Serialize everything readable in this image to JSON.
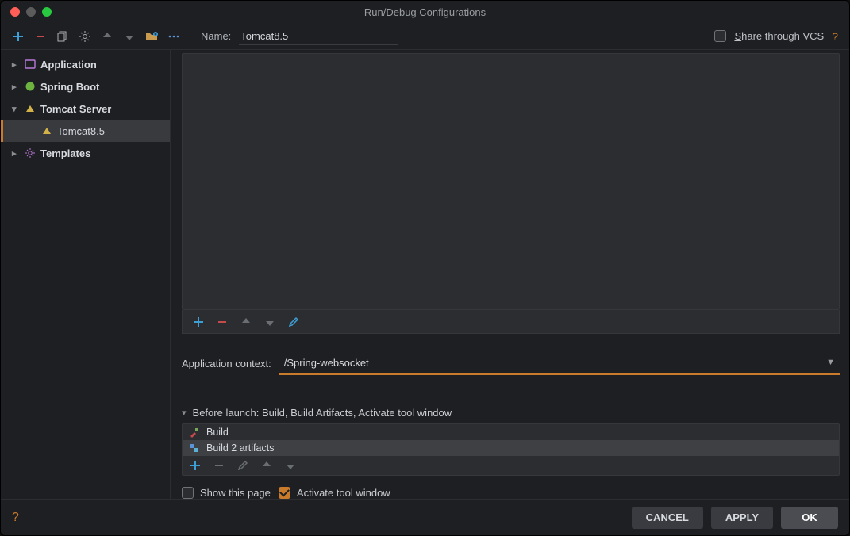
{
  "title": "Run/Debug Configurations",
  "toolbar": {
    "name_label": "Name:",
    "name_value": "Tomcat8.5",
    "share_label": "Share through VCS",
    "share_checked": false
  },
  "tree": {
    "application": "Application",
    "spring_boot": "Spring Boot",
    "tomcat_server": "Tomcat Server",
    "tomcat_child": "Tomcat8.5",
    "templates": "Templates"
  },
  "main": {
    "app_context_label": "Application context:",
    "app_context_value": "/Spring-websocket",
    "before_launch": "Before launch: Build, Build Artifacts, Activate tool window",
    "task_build": "Build",
    "task_artifacts": "Build 2 artifacts",
    "show_page": "Show this page",
    "activate_window": "Activate tool window"
  },
  "footer": {
    "cancel": "CANCEL",
    "apply": "APPLY",
    "ok": "OK"
  }
}
